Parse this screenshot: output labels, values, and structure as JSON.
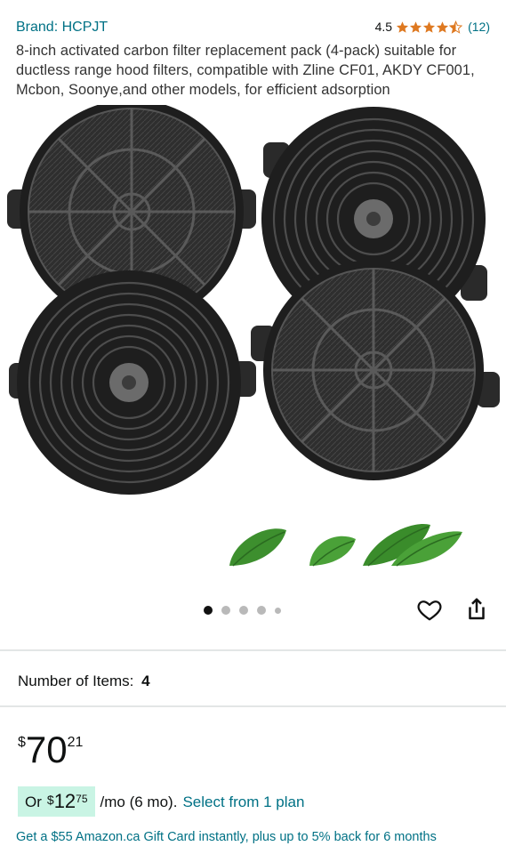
{
  "product": {
    "brand": "Brand: HCPJT",
    "rating_value": "4.5",
    "review_count": "(12)",
    "title": "8-inch activated carbon filter replacement pack (4-pack) suitable for ductless range hood filters, compatible with Zline CF01, AKDY CF001, Mcbon, Soonye,and other models, for efficient adsorption"
  },
  "rating_stars": {
    "value": 4.5,
    "max": 5,
    "color": "#de7921"
  },
  "gallery": {
    "image_count": 5,
    "active_index": 0
  },
  "actions": {
    "wishlist_icon": "heart-icon",
    "share_icon": "share-icon"
  },
  "variation": {
    "label": "Number of Items:",
    "value": "4"
  },
  "price": {
    "symbol": "$",
    "whole": "70",
    "fraction": "21"
  },
  "monthly": {
    "prefix": "Or",
    "symbol": "$",
    "whole": "12",
    "fraction": "75",
    "term": "/mo (6 mo).",
    "link": "Select from 1 plan"
  },
  "promo": {
    "giftcard": "Get a $55 Amazon.ca Gift Card instantly, plus up to 5% back for 6 months"
  },
  "colors": {
    "link": "#007185",
    "star": "#de7921",
    "monthly_bg": "#c9f4e4"
  }
}
